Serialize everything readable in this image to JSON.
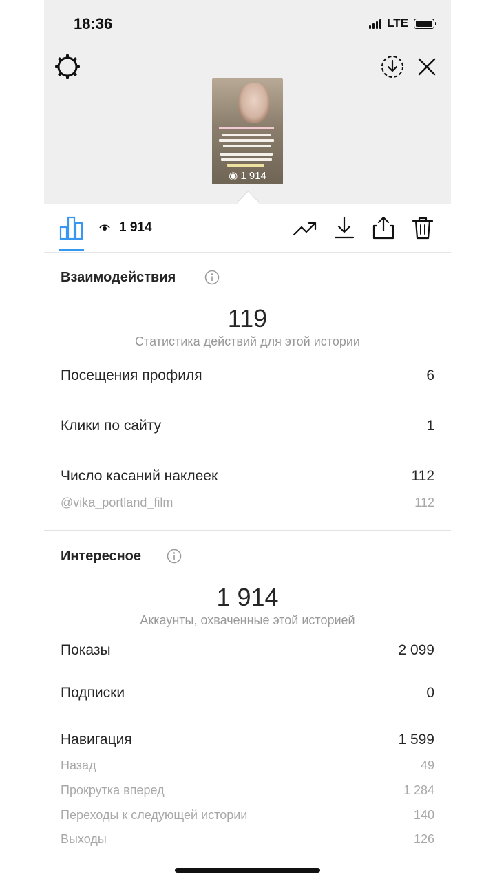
{
  "status_bar": {
    "time": "18:36",
    "network": "LTE"
  },
  "story": {
    "thumb_views": "1 914"
  },
  "toolbar": {
    "views": "1 914"
  },
  "interactions": {
    "title": "Взаимодействия",
    "total": "119",
    "caption": "Статистика действий для этой истории",
    "rows": [
      {
        "label": "Посещения профиля",
        "value": "6"
      },
      {
        "label": "Клики по сайту",
        "value": "1"
      },
      {
        "label": "Число касаний наклеек",
        "value": "112"
      }
    ],
    "sub_rows": [
      {
        "label": "@vika_portland_film",
        "value": "112"
      }
    ]
  },
  "discovery": {
    "title": "Интересное",
    "total": "1 914",
    "caption": "Аккаунты, охваченные этой историей",
    "rows": [
      {
        "label": "Показы",
        "value": "2 099"
      },
      {
        "label": "Подписки",
        "value": "0"
      },
      {
        "label": "Навигация",
        "value": "1 599"
      }
    ],
    "sub_rows": [
      {
        "label": "Назад",
        "value": "49"
      },
      {
        "label": "Прокрутка вперед",
        "value": "1 284"
      },
      {
        "label": "Переходы к следующей истории",
        "value": "140"
      },
      {
        "label": "Выходы",
        "value": "126"
      }
    ]
  },
  "colors": {
    "accent": "#3897f0",
    "text": "#262626",
    "muted": "#999999"
  }
}
